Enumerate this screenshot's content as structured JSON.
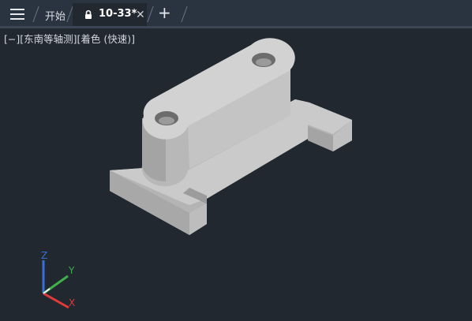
{
  "tabs": {
    "start_label": "开始",
    "active_label": "10-33*",
    "active_modified": true
  },
  "viewport": {
    "view_control": "[−]",
    "view_name": "[东南等轴测]",
    "visual_style": "[着色 (快速)]"
  },
  "ucs_axes": {
    "z_label": "Z",
    "y_label": "Y",
    "x_label": "X"
  },
  "colors": {
    "background": "#212830",
    "tabbar": "#2a3340",
    "axis_x": "#e03a3a",
    "axis_y": "#3fb04a",
    "axis_z": "#3a6fd8"
  },
  "icons": [
    "menu-icon",
    "lock-icon",
    "close-icon",
    "plus-icon"
  ]
}
